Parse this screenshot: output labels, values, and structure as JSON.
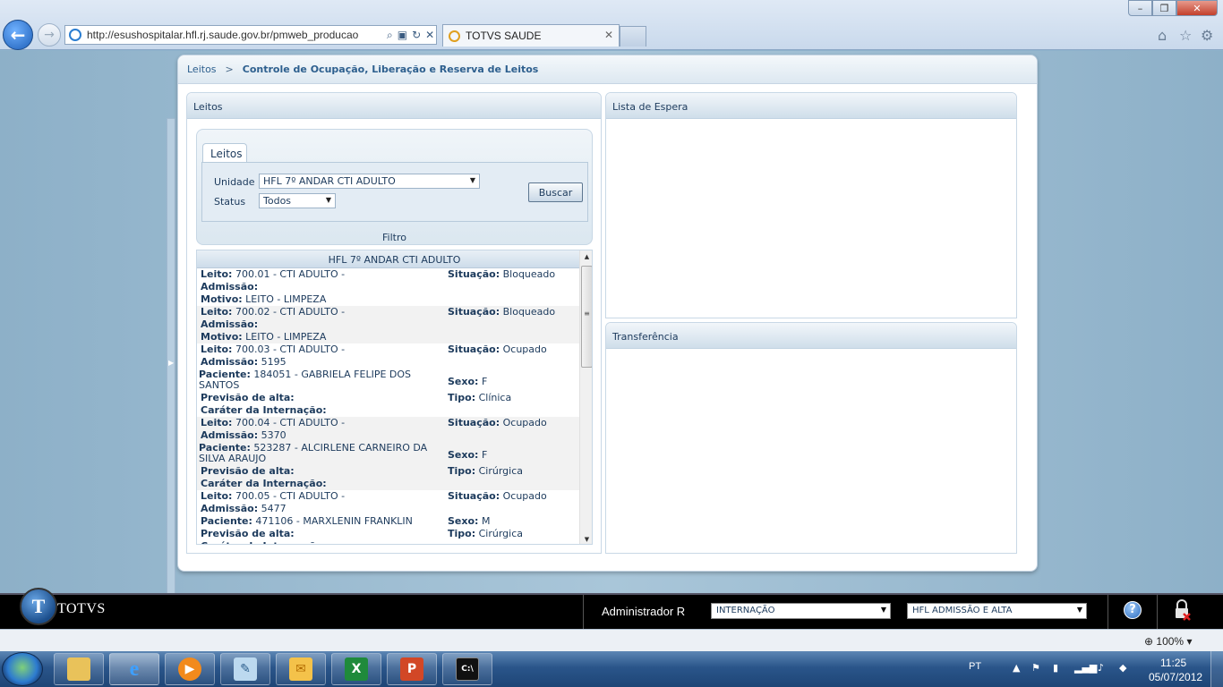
{
  "browser": {
    "address": "http://esushospitalar.hfl.rj.saude.gov.br/pmweb_producao",
    "tab_title": "TOTVS SAUDE",
    "tab_close": "✕",
    "win_min": "–",
    "win_max": "❐",
    "win_close": "✕",
    "zoom": "100%"
  },
  "breadcrumb": {
    "root": "Leitos",
    "separator": ">",
    "current": "Controle de Ocupação, Liberação e Reserva de Leitos"
  },
  "leitos_panel": {
    "title": "Leitos",
    "filter_tab": "Leitos",
    "unidade_label": "Unidade",
    "unidade_value": "HFL 7º ANDAR CTI ADULTO",
    "status_label": "Status",
    "status_value": "Todos",
    "buscar_label": "Buscar",
    "filtro_label": "Filtro",
    "list_header": "HFL 7º ANDAR CTI ADULTO"
  },
  "labels": {
    "leito": "Leito:",
    "situacao": "Situação:",
    "admissao": "Admissão:",
    "motivo": "Motivo:",
    "paciente": "Paciente:",
    "sexo": "Sexo:",
    "previsao": "Previsão de alta:",
    "tipo": "Tipo:",
    "carater": "Caráter da Internação:"
  },
  "beds": [
    {
      "leito": "700.01 - CTI ADULTO -",
      "situacao": "Bloqueado",
      "admissao": "",
      "motivo": "LEITO - LIMPEZA"
    },
    {
      "leito": "700.02 - CTI ADULTO -",
      "situacao": "Bloqueado",
      "admissao": "",
      "motivo": "LEITO - LIMPEZA"
    },
    {
      "leito": "700.03 - CTI ADULTO -",
      "situacao": "Ocupado",
      "admissao": "5195",
      "paciente": "184051 - GABRIELA FELIPE DOS SANTOS",
      "sexo": "F",
      "previsao": "",
      "tipo": "Clínica",
      "carater": ""
    },
    {
      "leito": "700.04 - CTI ADULTO -",
      "situacao": "Ocupado",
      "admissao": "5370",
      "paciente": "523287 - ALCIRLENE CARNEIRO DA SILVA ARAUJO",
      "sexo": "F",
      "previsao": "",
      "tipo": "Cirúrgica",
      "carater": ""
    },
    {
      "leito": "700.05 - CTI ADULTO -",
      "situacao": "Ocupado",
      "admissao": "5477",
      "paciente": "471106 - MARXLENIN FRANKLIN",
      "sexo": "M",
      "previsao": "",
      "tipo": "Cirúrgica"
    }
  ],
  "espera_panel": {
    "title": "Lista de Espera"
  },
  "transferencia_panel": {
    "title": "Transferência"
  },
  "footer": {
    "brand": "TOTVS",
    "user": "Administrador R",
    "module": "INTERNAÇÃO",
    "unit": "HFL ADMISSÃO E ALTA",
    "help": "?"
  },
  "taskbar": {
    "lang": "PT",
    "time": "11:25",
    "date": "05/07/2012"
  },
  "colors": {
    "accent": "#1c3a5c",
    "panel_header": "#cfdeea",
    "footer_bg": "#000000"
  }
}
